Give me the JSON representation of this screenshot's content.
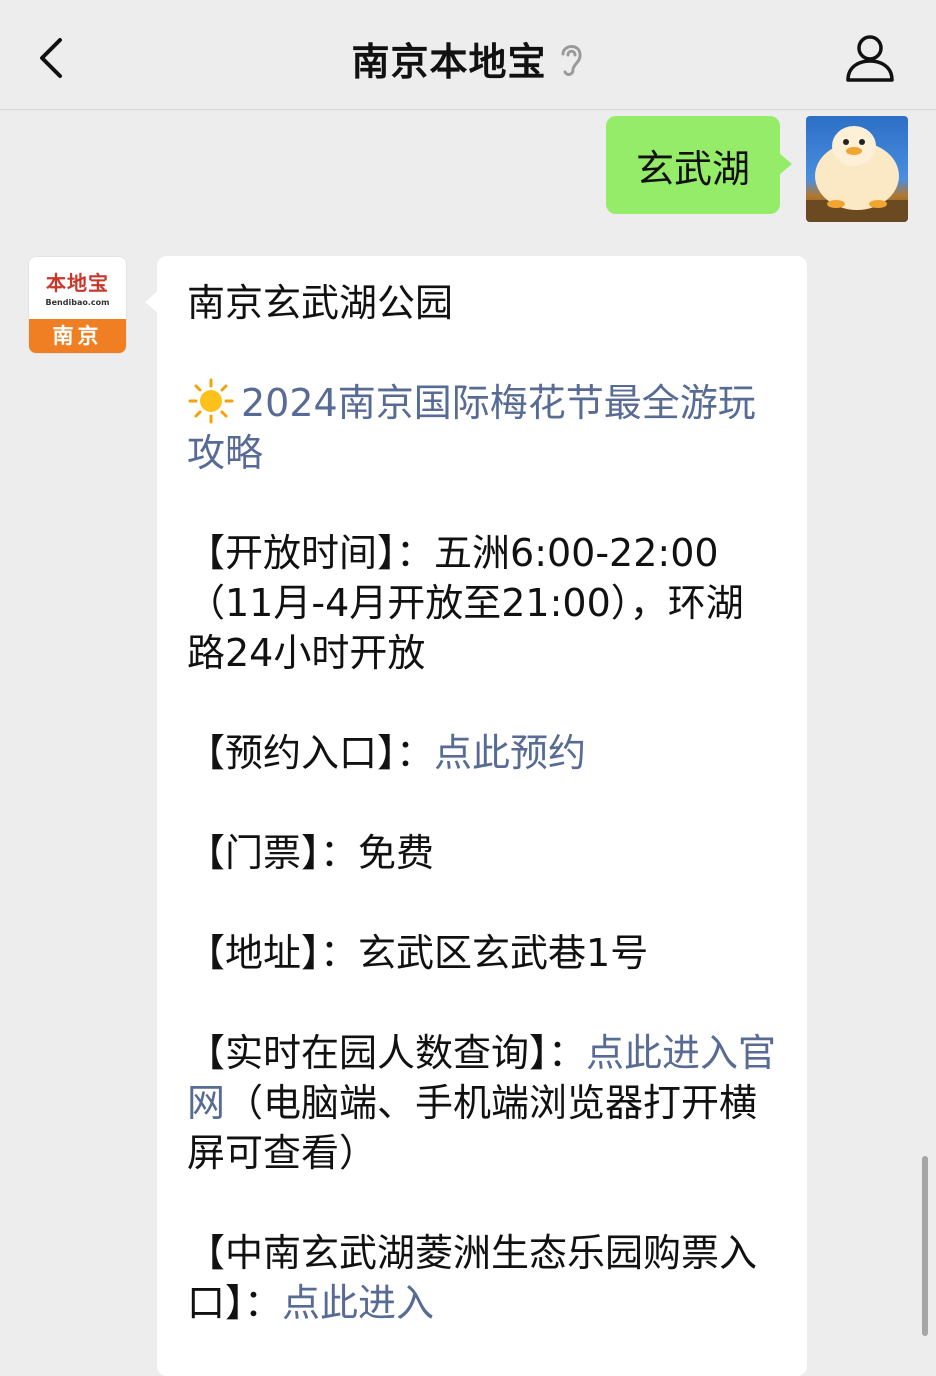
{
  "header": {
    "title": "南京本地宝",
    "back_icon": "chevron-left-icon",
    "ear_icon": "ear-icon",
    "user_icon": "person-icon"
  },
  "messages": {
    "outgoing": {
      "text": "玄武湖",
      "avatar": "duck-avatar"
    },
    "incoming": {
      "avatar": {
        "logo_cn": "本地宝",
        "logo_en": "Bendibao.com",
        "city": "南京",
        "brand_color": "#ef7f22"
      },
      "title": "南京玄武湖公园",
      "guide_icon": "sun-icon",
      "guide_link": "2024南京国际梅花节最全游玩攻略",
      "hours_label": "【开放时间】：",
      "hours_value": "五洲6:00-22:00（11月-4月开放至21:00），环湖路24小时开放",
      "reserve_label": "【预约入口】：",
      "reserve_link": "点此预约",
      "ticket_label": "【门票】：",
      "ticket_value": "免费",
      "address_label": "【地址】：",
      "address_value": "玄武区玄武巷1号",
      "realtime_label": "【实时在园人数查询】：",
      "realtime_link": "点此进入官网",
      "realtime_note": "（电脑端、手机端浏览器打开横屏可查看）",
      "park_ticket_label": "【中南玄武湖菱洲生态乐园购票入口】：",
      "park_ticket_link": "点此进入"
    }
  },
  "colors": {
    "bubble_out": "#95ec69",
    "link": "#576b95",
    "background": "#ededed"
  }
}
